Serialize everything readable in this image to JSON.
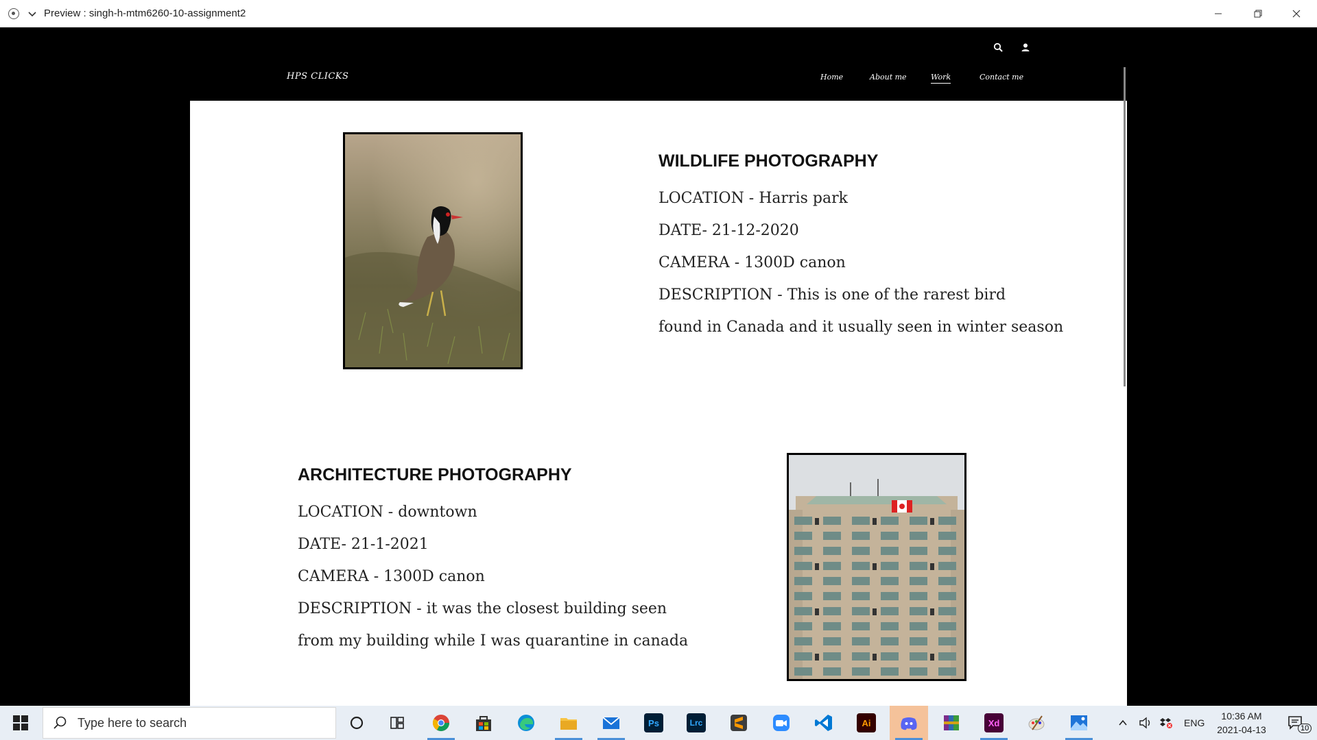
{
  "window": {
    "title": "Preview : singh-h-mtm6260-10-assignment2"
  },
  "site": {
    "brand": "HPS CLICKS",
    "nav": [
      "Home",
      "About me",
      "Work",
      "Contact me"
    ],
    "active_nav": "Work"
  },
  "sections": [
    {
      "title": "WILDLIFE PHOTOGRAPHY",
      "location": "LOCATION - Harris park",
      "date": "DATE- 21-12-2020",
      "camera": "CAMERA - 1300D canon",
      "description_1": "DESCRIPTION - This is one of the rarest bird",
      "description_2": "found in Canada and it usually seen in winter season"
    },
    {
      "title": "ARCHITECTURE PHOTOGRAPHY",
      "location": "LOCATION - downtown",
      "date": "DATE- 21-1-2021",
      "camera": "CAMERA - 1300D canon",
      "description_1": "DESCRIPTION - it was the closest building seen",
      "description_2": "from my building while I was quarantine in canada"
    }
  ],
  "taskbar": {
    "search_placeholder": "Type here to search",
    "apps": [
      "task-view",
      "chrome",
      "store",
      "edge",
      "file-explorer",
      "mail",
      "photoshop",
      "lightroom-classic",
      "sublime-text",
      "zoom",
      "vscode",
      "illustrator",
      "discord",
      "winrar",
      "adobe-xd",
      "paint",
      "photos"
    ],
    "app_labels": {
      "photoshop": "Ps",
      "lightroom": "Lrc",
      "illustrator": "Ai",
      "xd": "Xd"
    },
    "language": "ENG",
    "time": "10:36 AM",
    "date": "2021-04-13",
    "notification_count": "10"
  },
  "colors": {
    "header_bg": "#000000",
    "content_bg": "#ffffff",
    "taskbar_bg": "#e8eef5",
    "discord_highlight": "#f5c29a"
  }
}
